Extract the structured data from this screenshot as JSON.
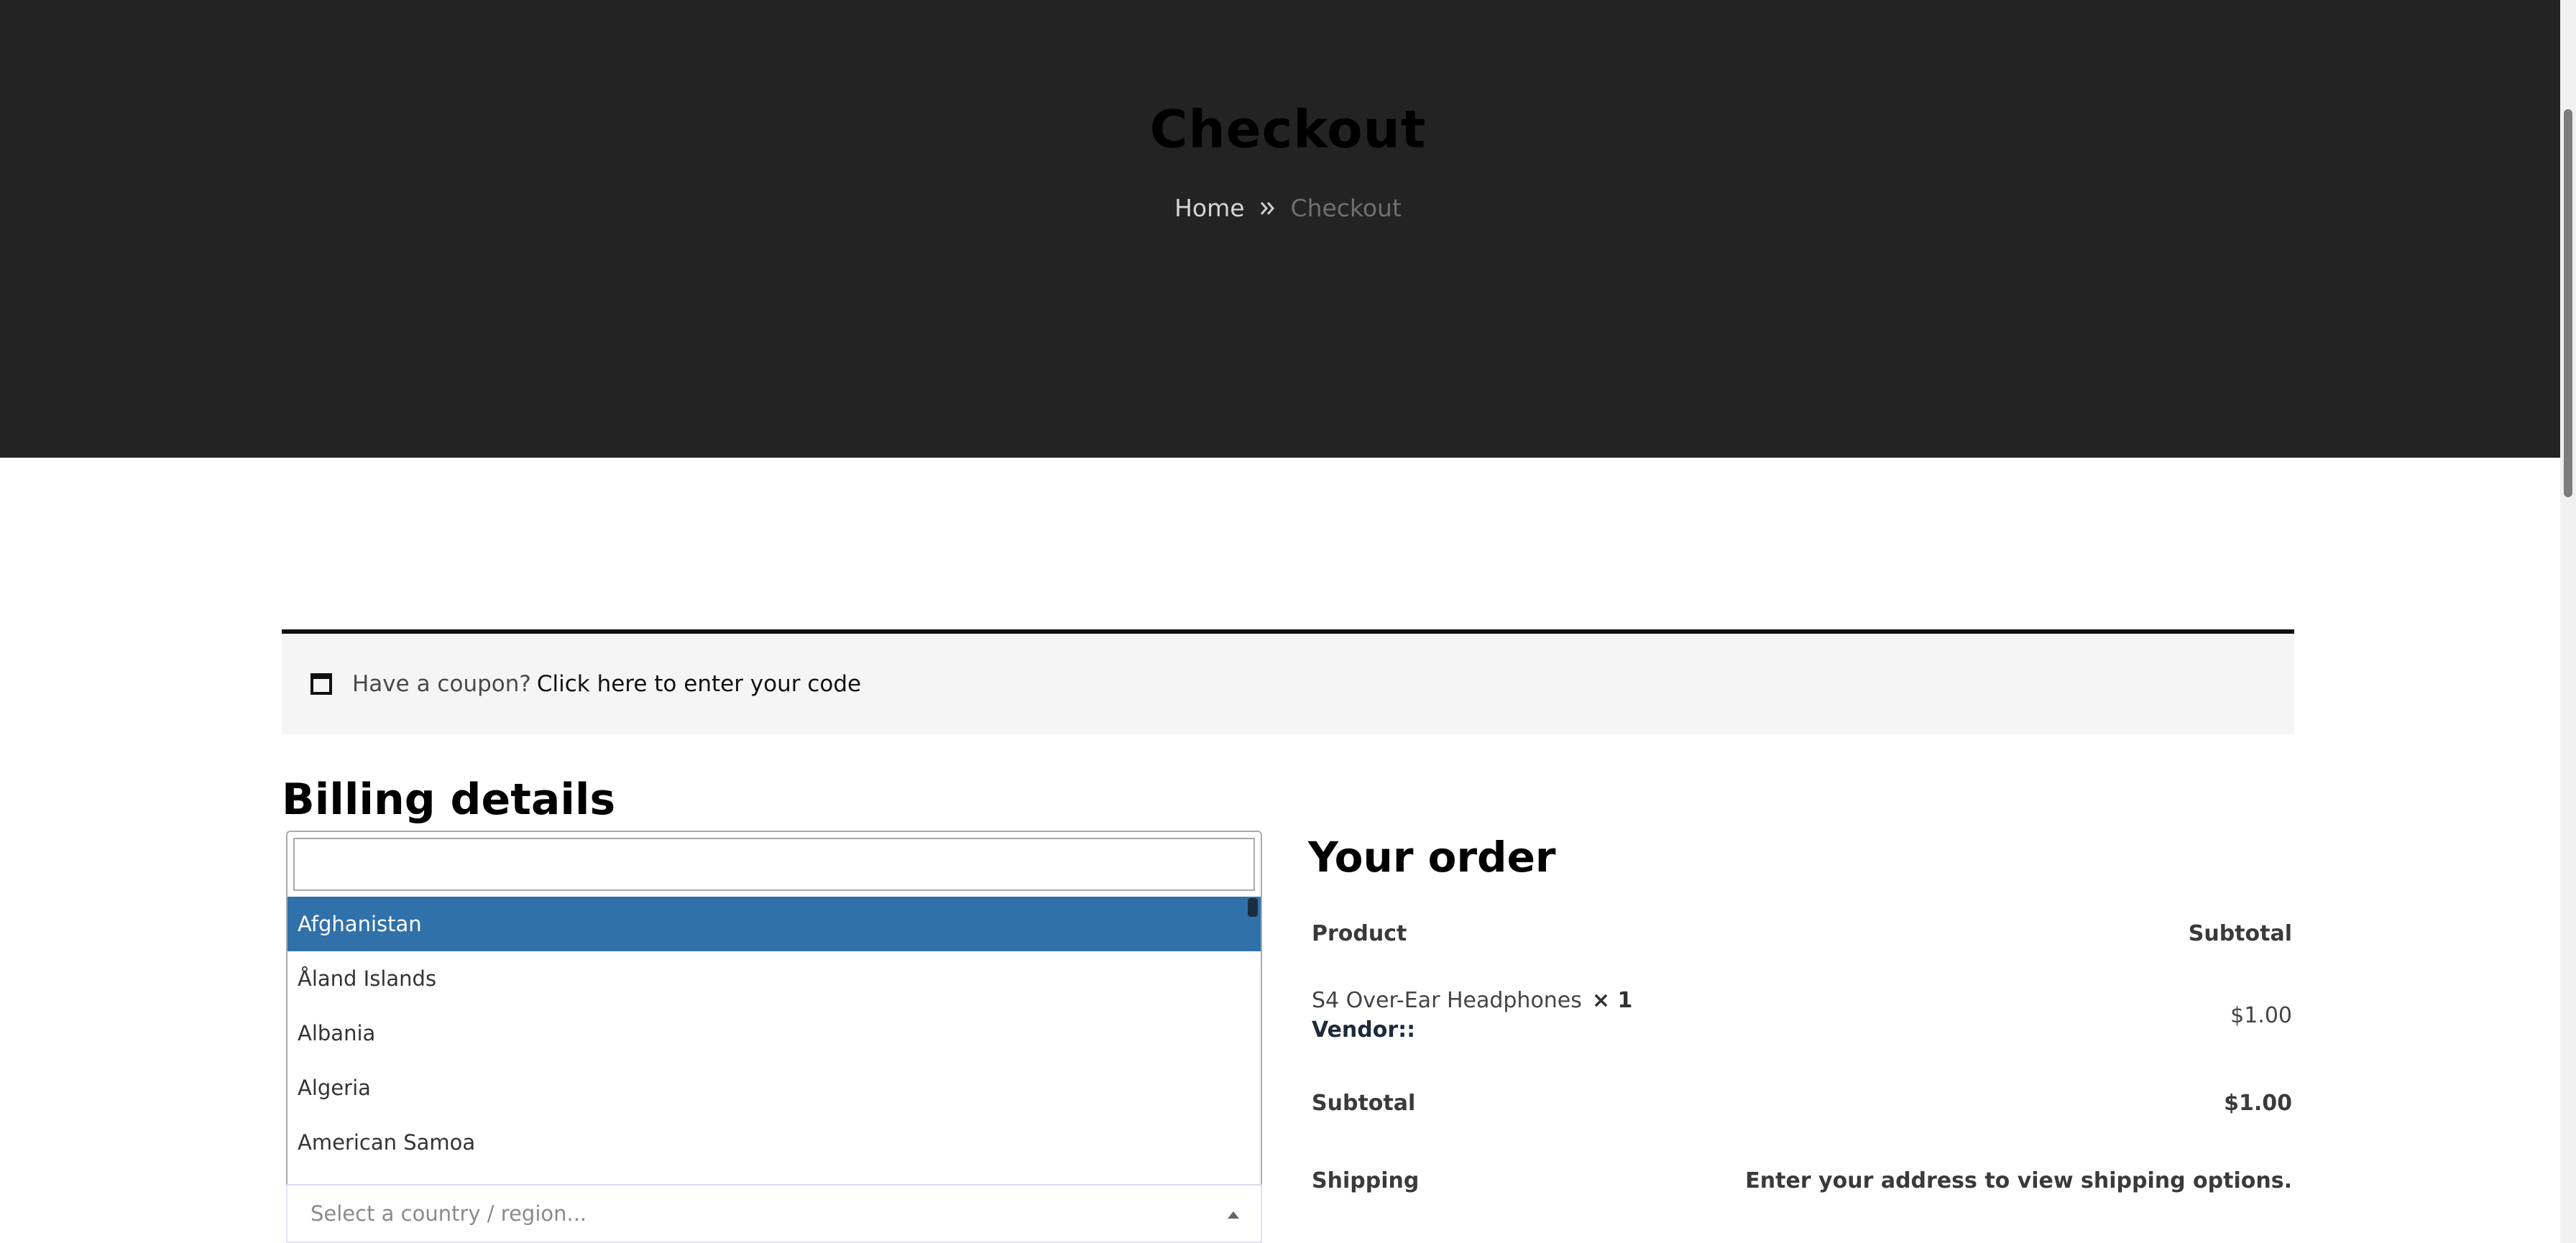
{
  "hero": {
    "title": "Checkout",
    "breadcrumb": {
      "home": "Home",
      "current": "Checkout"
    }
  },
  "coupon": {
    "text": "Have a coupon?",
    "link": "Click here to enter your code"
  },
  "billing": {
    "title": "Billing details",
    "country_search": {
      "value": ""
    },
    "country_options": [
      "Afghanistan",
      "Åland Islands",
      "Albania",
      "Algeria",
      "American Samoa"
    ],
    "selected_option": "Afghanistan",
    "country_placeholder": "Select a country / region..."
  },
  "order": {
    "title": "Your order",
    "header": {
      "product": "Product",
      "subtotal": "Subtotal"
    },
    "item": {
      "name": "S4 Over-Ear Headphones",
      "qty": "× 1",
      "vendor": "Vendor::",
      "price": "$1.00"
    },
    "subtotal": {
      "label": "Subtotal",
      "value": "$1.00"
    },
    "shipping": {
      "label": "Shipping",
      "value": "Enter your address to view shipping options."
    }
  },
  "colors": {
    "hero_bg": "#232323",
    "selected_option_bg": "#3071a9",
    "coupon_bg": "#f5f5f5"
  },
  "icons": [
    "chevrons-right-icon",
    "window-icon",
    "caret-up-icon"
  ]
}
